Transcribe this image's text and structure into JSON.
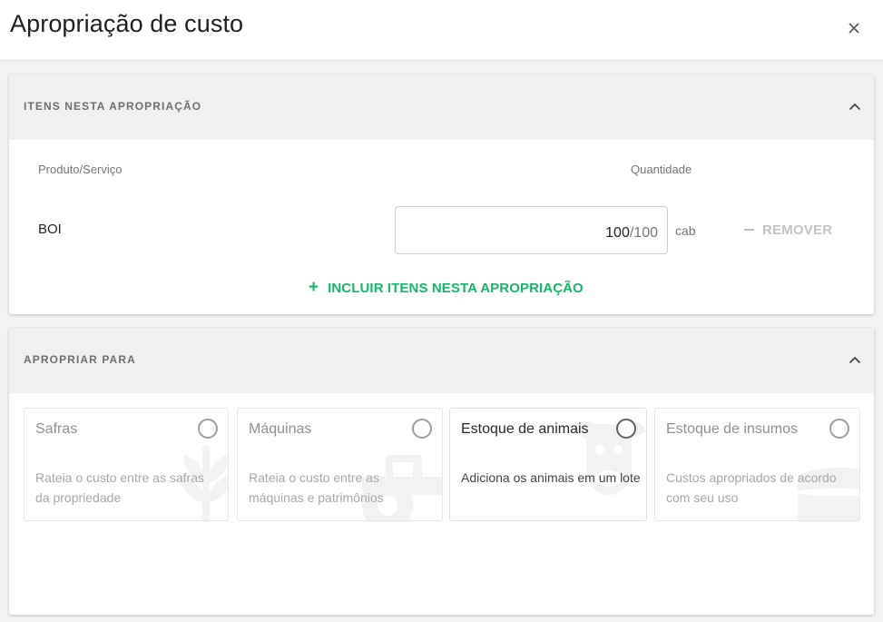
{
  "dialog": {
    "title": "Apropriação de custo",
    "close_icon": "close-icon"
  },
  "items_section": {
    "title": "ITENS NESTA APROPRIAÇÃO",
    "collapse_icon": "chevron-up-icon",
    "columns": {
      "product": "Produto/Serviço",
      "quantity": "Quantidade"
    },
    "rows": [
      {
        "name": "BOI",
        "quantity": "100",
        "quantity_total": "/100",
        "unit": "cab",
        "remove_label": "REMOVER",
        "remove_icon": "minus-icon"
      }
    ],
    "add_label": "INCLUIR ITENS NESTA APROPRIAÇÃO",
    "add_icon": "plus-icon"
  },
  "target_section": {
    "title": "APROPRIAR PARA",
    "collapse_icon": "chevron-up-icon",
    "options": [
      {
        "title": "Safras",
        "description": "Rateia o custo entre as safras da propriedade",
        "icon": "wheat-icon",
        "state": "disabled"
      },
      {
        "title": "Máquinas",
        "description": "Rateia o custo entre as máquinas e patrimônios",
        "icon": "tractor-icon",
        "state": "disabled"
      },
      {
        "title": "Estoque de animais",
        "description": "Adiciona os animais em um lote",
        "icon": "cow-icon",
        "state": "enabled"
      },
      {
        "title": "Estoque de insumos",
        "description": "Custos apropriados de acordo com seu uso",
        "icon": "stacked-coins-icon",
        "state": "disabled"
      }
    ]
  },
  "colors": {
    "accent": "#14b86a",
    "disabled_text": "#a7a7a7",
    "section_header_bg": "#f1f1f1"
  }
}
